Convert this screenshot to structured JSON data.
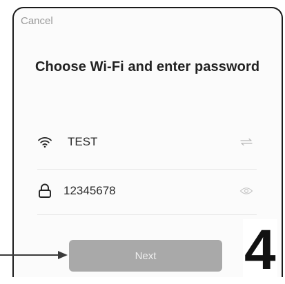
{
  "header": {
    "cancel_label": "Cancel",
    "title": "Choose Wi-Fi and enter password"
  },
  "wifi_row": {
    "icon": "wifi-icon",
    "ssid": "TEST",
    "trailing_icon": "switch-network-icon"
  },
  "password_row": {
    "icon": "lock-icon",
    "value": "12345678",
    "trailing_icon": "eye-icon"
  },
  "actions": {
    "next_label": "Next"
  },
  "annotation": {
    "step_number": "4",
    "pointer": "arrow-right-icon"
  },
  "colors": {
    "button_bg": "#a9a9a9",
    "button_text": "#efefef",
    "cancel_text": "#9a9a9a",
    "title_text": "#222222"
  }
}
